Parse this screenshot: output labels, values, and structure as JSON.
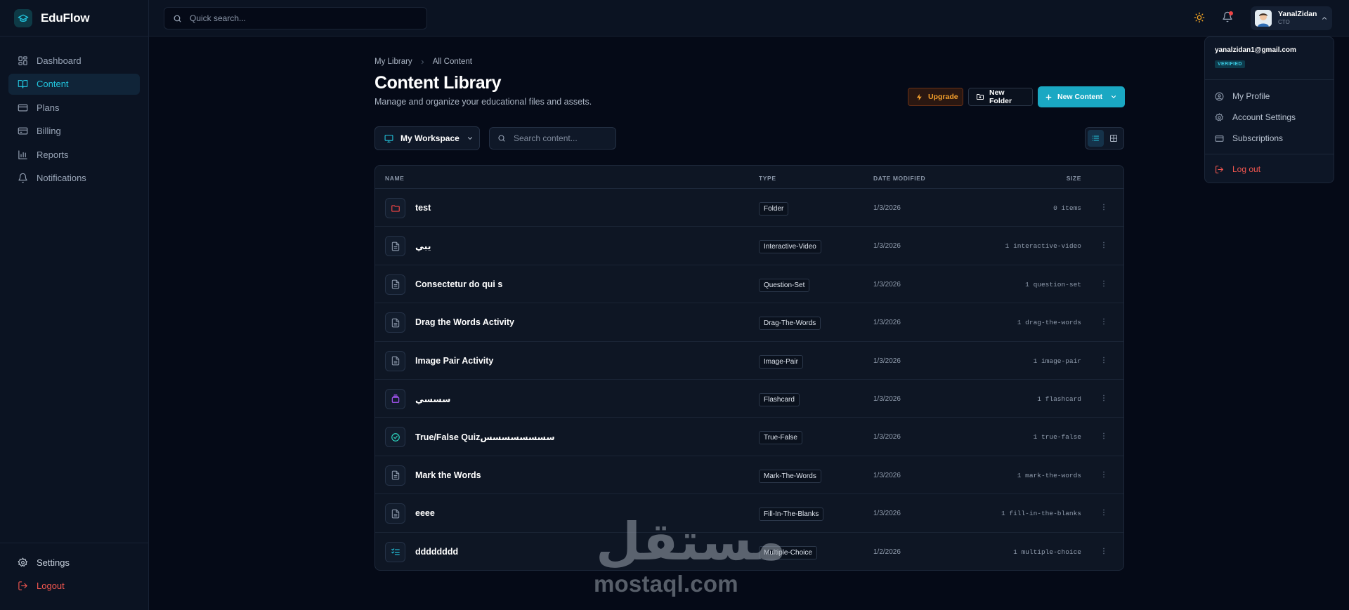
{
  "app": {
    "name": "EduFlow"
  },
  "sidebar": {
    "items": [
      {
        "label": "Dashboard",
        "icon": "dashboard-icon"
      },
      {
        "label": "Content",
        "icon": "book-icon",
        "active": true
      },
      {
        "label": "Plans",
        "icon": "card-icon"
      },
      {
        "label": "Billing",
        "icon": "billing-icon"
      },
      {
        "label": "Reports",
        "icon": "bar-chart-icon"
      },
      {
        "label": "Notifications",
        "icon": "bell-icon"
      }
    ],
    "bottom": [
      {
        "label": "Settings",
        "icon": "gear-icon"
      },
      {
        "label": "Logout",
        "icon": "logout-icon"
      }
    ]
  },
  "topbar": {
    "search_placeholder": "Quick search...",
    "user": {
      "name": "YanalZidan",
      "role": "CTO"
    }
  },
  "user_menu": {
    "email": "yanalzidan1@gmail.com",
    "badge": "VERIFIED",
    "items": [
      "My Profile",
      "Account Settings",
      "Subscriptions"
    ],
    "logout": "Log out"
  },
  "breadcrumb": [
    "My Library",
    "All Content"
  ],
  "page": {
    "title": "Content Library",
    "subtitle": "Manage and organize your educational files and assets."
  },
  "actions": {
    "upgrade": "Upgrade",
    "new_folder": "New Folder",
    "new_content": "New Content"
  },
  "filters": {
    "workspace": "My Workspace",
    "search_placeholder": "Search content..."
  },
  "table": {
    "headers": {
      "name": "NAME",
      "type": "TYPE",
      "date": "DATE MODIFIED",
      "size": "SIZE"
    },
    "rows": [
      {
        "name": "test",
        "type": "Folder",
        "date": "1/3/2026",
        "size": "0 items",
        "icon": "folder-icon"
      },
      {
        "name": "يبي",
        "type": "Interactive-Video",
        "date": "1/3/2026",
        "size": "1 interactive-video",
        "icon": "file-icon"
      },
      {
        "name": "Consectetur do qui s",
        "type": "Question-Set",
        "date": "1/3/2026",
        "size": "1 question-set",
        "icon": "file-icon"
      },
      {
        "name": "Drag the Words Activity",
        "type": "Drag-The-Words",
        "date": "1/3/2026",
        "size": "1 drag-the-words",
        "icon": "file-icon"
      },
      {
        "name": "Image Pair Activity",
        "type": "Image-Pair",
        "date": "1/3/2026",
        "size": "1 image-pair",
        "icon": "file-icon"
      },
      {
        "name": "سسسي",
        "type": "Flashcard",
        "date": "1/3/2026",
        "size": "1 flashcard",
        "icon": "flashcard-icon"
      },
      {
        "name": "True/False Quizسسسسسسسس",
        "type": "True-False",
        "date": "1/3/2026",
        "size": "1 true-false",
        "icon": "check-circle-icon"
      },
      {
        "name": "Mark the Words",
        "type": "Mark-The-Words",
        "date": "1/3/2026",
        "size": "1 mark-the-words",
        "icon": "file-icon"
      },
      {
        "name": "eeee",
        "type": "Fill-In-The-Blanks",
        "date": "1/3/2026",
        "size": "1 fill-in-the-blanks",
        "icon": "file-icon"
      },
      {
        "name": "dddddddd",
        "type": "Multiple-Choice",
        "date": "1/2/2026",
        "size": "1 multiple-choice",
        "icon": "list-check-icon"
      }
    ]
  },
  "watermark": {
    "arabic": "مستقل",
    "latin": "mostaql.com"
  },
  "colors": {
    "accent": "#22c6df",
    "danger": "#f0564f",
    "upgrade": "#f7a12c",
    "background": "#050a17"
  }
}
